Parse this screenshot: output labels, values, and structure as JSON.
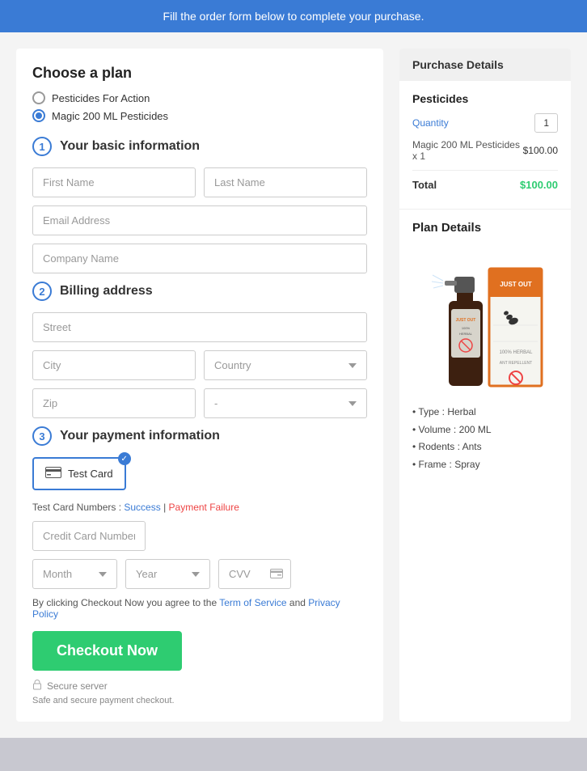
{
  "banner": {
    "text": "Fill the order form below to complete your purchase."
  },
  "leftPanel": {
    "choosePlan": {
      "title": "Choose a plan",
      "options": [
        {
          "label": "Pesticides For Action",
          "selected": false
        },
        {
          "label": "Magic 200 ML Pesticides",
          "selected": true
        }
      ]
    },
    "step1": {
      "number": "1",
      "title": "Your basic information",
      "fields": {
        "firstName": "First Name",
        "lastName": "Last Name",
        "email": "Email Address",
        "company": "Company Name"
      }
    },
    "step2": {
      "number": "2",
      "title": "Billing address",
      "fields": {
        "street": "Street",
        "city": "City",
        "country": "Country",
        "zip": "Zip",
        "state": "-"
      }
    },
    "step3": {
      "number": "3",
      "title": "Your payment information",
      "cardOption": {
        "label": "Test Card"
      },
      "testCardInfo": {
        "prefix": "Test Card Numbers : ",
        "success": "Success",
        "separator": " | ",
        "failure": "Payment Failure"
      },
      "fields": {
        "creditCardNumber": "Credit Card Number",
        "month": "Month",
        "year": "Year",
        "cvv": "CVV"
      }
    },
    "terms": {
      "text1": "By clicking Checkout Now you agree to the ",
      "link1": "Term of Service",
      "text2": " and ",
      "link2": "Privacy Policy"
    },
    "checkoutBtn": "Checkout Now",
    "secureServer": "Secure server",
    "securePayment": "Safe and secure payment checkout."
  },
  "rightPanel": {
    "purchaseDetails": {
      "header": "Purchase Details",
      "sectionTitle": "Pesticides",
      "quantityLabel": "Quantity",
      "quantityValue": "1",
      "itemLabel": "Magic 200 ML Pesticides x 1",
      "itemPrice": "$100.00",
      "totalLabel": "Total",
      "totalPrice": "$100.00"
    },
    "planDetails": {
      "title": "Plan Details",
      "productFeatures": [
        "Type : Herbal",
        "Volume : 200 ML",
        "Rodents : Ants",
        "Frame : Spray"
      ]
    }
  }
}
